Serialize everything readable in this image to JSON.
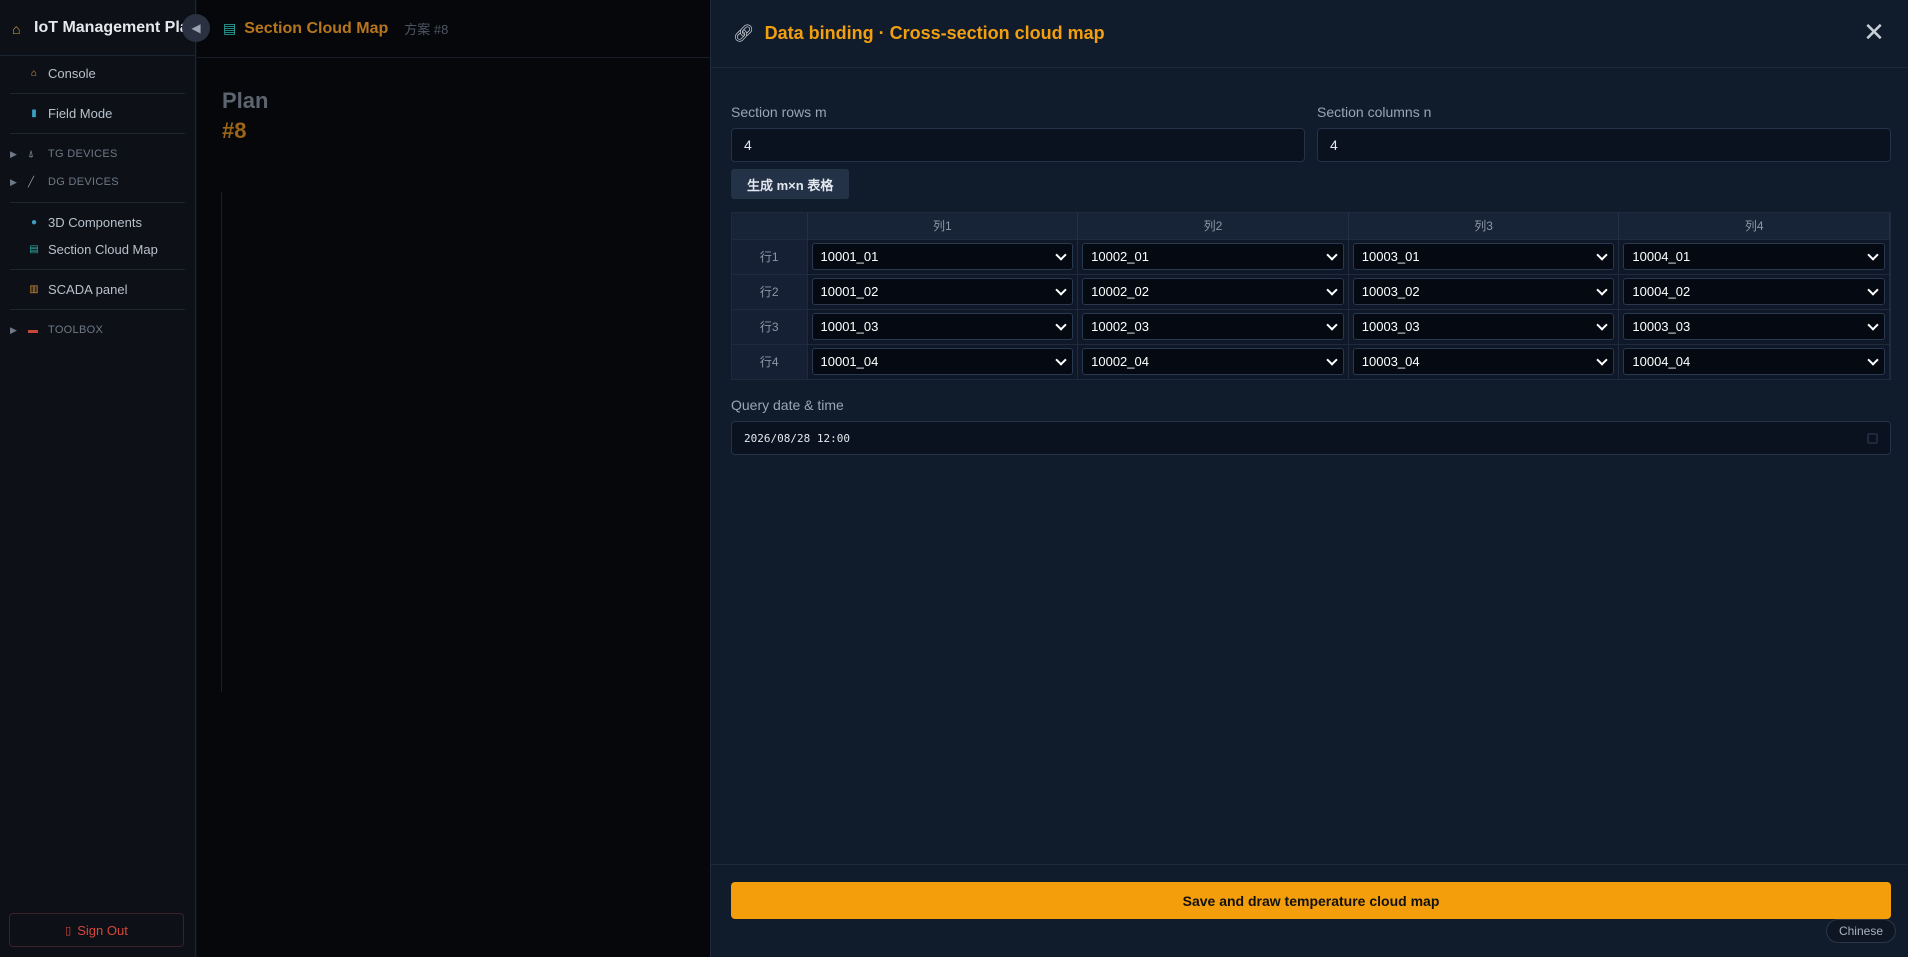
{
  "sidebar": {
    "title": "IoT Management Platform",
    "collapse_icon": "◀",
    "items": {
      "console": "Console",
      "field_mode": "Field Mode",
      "tg_devices": "TG DEVICES",
      "dg_devices": "DG DEVICES",
      "components_3d": "3D Components",
      "section_cloud_map": "Section Cloud Map",
      "scada_panel": "SCADA panel",
      "toolbox": "TOOLBOX"
    },
    "sign_out": "Sign Out"
  },
  "main": {
    "title": "Section Cloud Map",
    "subtitle": "方案 #8",
    "plan_label": "Plan",
    "plan_number": "#8"
  },
  "drawer": {
    "title": "Data binding · Cross-section cloud map",
    "close_symbol": "✕",
    "rows_label": "Section rows m",
    "rows_value": "4",
    "cols_label": "Section columns n",
    "cols_value": "4",
    "generate_button": "生成 m×n 表格",
    "grid": {
      "columns": [
        "列1",
        "列2",
        "列3",
        "列4"
      ],
      "rows": [
        {
          "label": "行1",
          "cells": [
            "10001_01",
            "10002_01",
            "10003_01",
            "10004_01"
          ]
        },
        {
          "label": "行2",
          "cells": [
            "10001_02",
            "10002_02",
            "10003_02",
            "10004_02"
          ]
        },
        {
          "label": "行3",
          "cells": [
            "10001_03",
            "10002_03",
            "10003_03",
            "10003_03"
          ]
        },
        {
          "label": "行4",
          "cells": [
            "10001_04",
            "10002_04",
            "10003_04",
            "10004_04"
          ]
        }
      ]
    },
    "query_label": "Query date & time",
    "query_value": "2026/08/28  12:00",
    "save_button": "Save and draw temperature cloud map",
    "language_button": "Chinese"
  },
  "colors": {
    "accent": "#f59e0b",
    "title_orange": "#f29f0f",
    "danger": "#d8463a",
    "drawer_bg": "#101b2c"
  }
}
